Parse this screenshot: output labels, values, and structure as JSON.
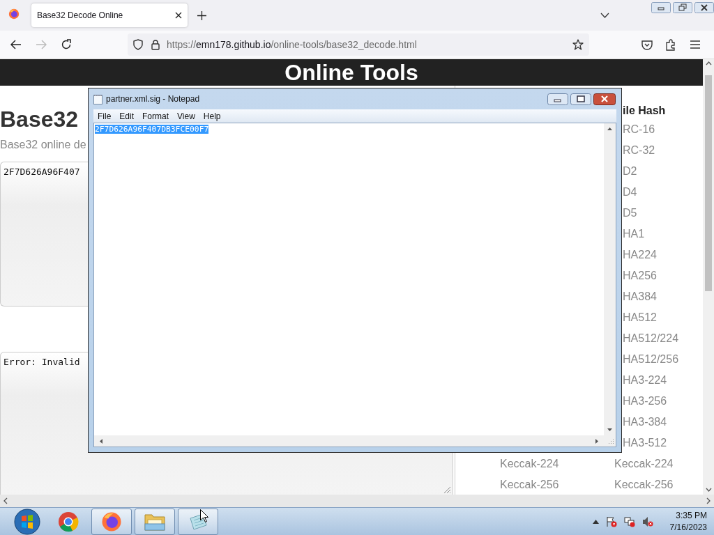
{
  "browser": {
    "tabs": [
      {
        "title": "Base32 Decode Online",
        "selected": true
      }
    ],
    "url": {
      "scheme": "https://",
      "host": "emn178.github.io",
      "path": "/online-tools/base32_decode.html"
    }
  },
  "page": {
    "site_title": "Online Tools",
    "heading": "Base32",
    "description": "Base32 online de",
    "input_value": "2F7D626A96F407",
    "output_value": "Error: Invalid",
    "side_heading": "ile Hash",
    "side_items": [
      "RC-16",
      "RC-32",
      "D2",
      "D4",
      "D5",
      "HA1",
      "HA224",
      "HA256",
      "HA384",
      "HA512",
      "HA512/224",
      "HA512/256",
      "HA3-224",
      "HA3-256",
      "HA3-384",
      "HA3-512"
    ],
    "side_rows": [
      [
        "Keccak-224",
        "Keccak-224"
      ],
      [
        "Keccak-256",
        "Keccak-256"
      ]
    ]
  },
  "notepad": {
    "title": "partner.xml.sig - Notepad",
    "menu": [
      "File",
      "Edit",
      "Format",
      "View",
      "Help"
    ],
    "text": "2F7D626A96F407DB3FCE00F7",
    "text_selected": true
  },
  "taskbar": {
    "apps": [
      {
        "kind": "chrome",
        "running": false
      },
      {
        "kind": "firefox",
        "running": true
      },
      {
        "kind": "explorer",
        "running": true
      },
      {
        "kind": "notepad",
        "running": true
      }
    ],
    "time": "3:35 PM",
    "date": "7/16/2023"
  }
}
